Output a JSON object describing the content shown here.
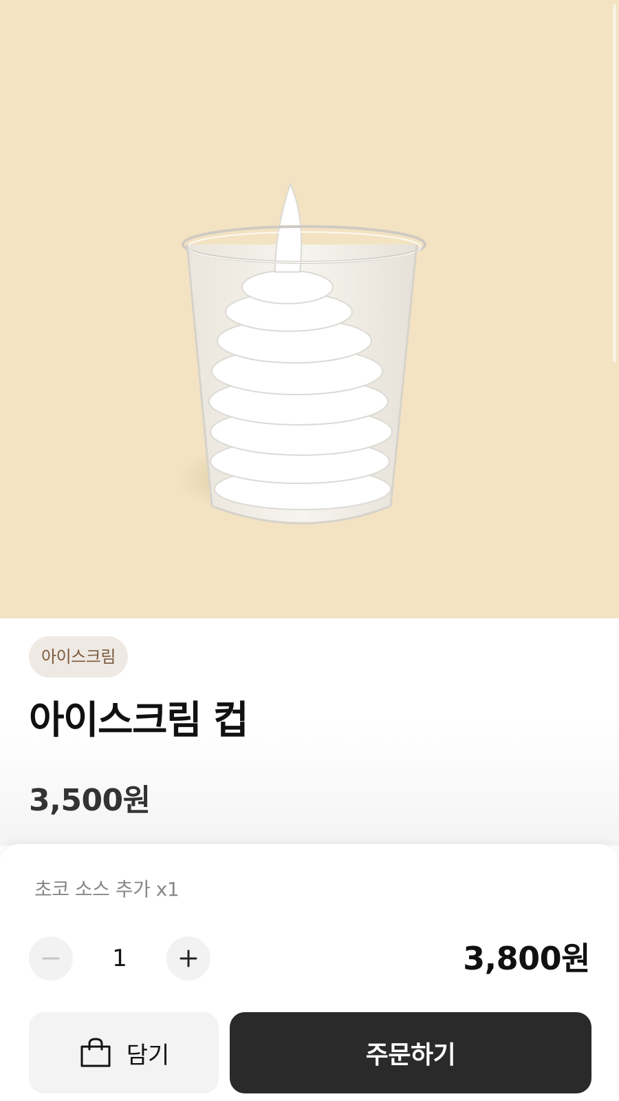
{
  "product": {
    "image_alt": "soft-serve-in-clear-cup",
    "category": "아이스크림",
    "name": "아이스크림 컵",
    "price": "3,500원"
  },
  "order": {
    "option_summary": "초코 소스 추가 x1",
    "quantity": "1",
    "total_price": "3,800원",
    "cart_label": "담기",
    "order_label": "주문하기"
  },
  "icons": {
    "minus": "minus-icon",
    "plus": "plus-icon",
    "cart": "shopping-bag-icon"
  },
  "colors": {
    "hero_background": "#f3e3c2",
    "category_chip_bg": "#efe9e4",
    "category_chip_text": "#7a5a3d",
    "order_button_bg": "#2a2a2a"
  }
}
